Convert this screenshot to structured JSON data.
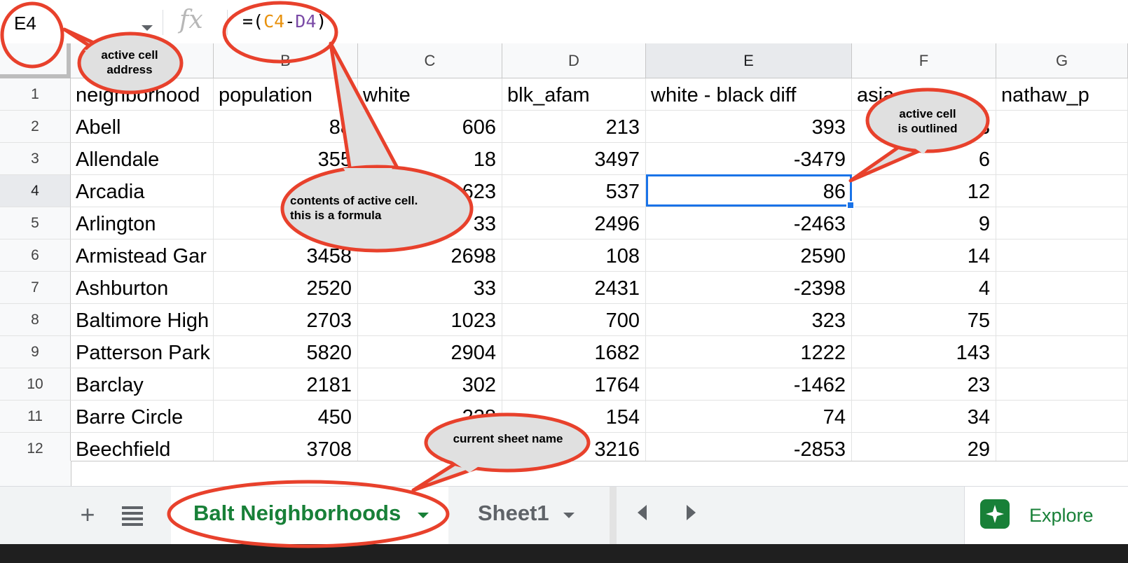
{
  "formula_bar": {
    "name_box": "E4",
    "fx_label": "fx",
    "formula": {
      "prefix": "=(",
      "ref1": "C4",
      "operator": "-",
      "ref2": "D4",
      "suffix": ")"
    }
  },
  "grid": {
    "columns": [
      "B",
      "C",
      "D",
      "E",
      "F",
      "G"
    ],
    "rows": [
      "1",
      "2",
      "3",
      "4",
      "5",
      "6",
      "7",
      "8",
      "9",
      "10",
      "11",
      "12"
    ],
    "header_row": [
      "neighborhood",
      "population",
      "white",
      "blk_afam",
      "white - black diff",
      "asia",
      "nathaw_p"
    ],
    "data": [
      [
        "Abell",
        "88",
        "606",
        "213",
        "393",
        "3",
        ""
      ],
      [
        "Allendale",
        "355",
        "18",
        "3497",
        "-3479",
        "6",
        ""
      ],
      [
        "Arcadia",
        "",
        "623",
        "537",
        "86",
        "12",
        ""
      ],
      [
        "Arlington",
        "",
        "33",
        "2496",
        "-2463",
        "9",
        ""
      ],
      [
        "Armistead Gar",
        "3458",
        "2698",
        "108",
        "2590",
        "14",
        ""
      ],
      [
        "Ashburton",
        "2520",
        "33",
        "2431",
        "-2398",
        "4",
        ""
      ],
      [
        "Baltimore High",
        "2703",
        "1023",
        "700",
        "323",
        "75",
        ""
      ],
      [
        "Patterson Park",
        "5820",
        "2904",
        "1682",
        "1222",
        "143",
        ""
      ],
      [
        "Barclay",
        "2181",
        "302",
        "1764",
        "-1462",
        "23",
        ""
      ],
      [
        "Barre Circle",
        "450",
        "228",
        "154",
        "74",
        "34",
        ""
      ],
      [
        "Beechfield",
        "3708",
        "",
        "3216",
        "-2853",
        "29",
        ""
      ]
    ],
    "active_cell": "E4"
  },
  "sheet_tabs": {
    "add_label": "+",
    "tabs": [
      {
        "name": "Balt Neighborhoods",
        "active": true
      },
      {
        "name": "Sheet1",
        "active": false
      }
    ],
    "explore_label": "Explore"
  },
  "annotations": {
    "active_cell_address": "active cell\naddress",
    "contents_of_active_cell": "contents of active cell.\nthis is a formula",
    "active_cell_outlined": "active cell\nis outlined",
    "current_sheet_name": "current sheet name"
  },
  "colors": {
    "accent_blue": "#1a73e8",
    "sheet_green": "#188038",
    "annotation_red": "#e8412c",
    "callout_fill": "#e0e0e0",
    "ref1_orange": "#e8910c",
    "ref2_purple": "#7a4aa6"
  },
  "icons": {
    "name_box_dropdown": "chevron-down-icon",
    "add_sheet": "plus-icon",
    "all_sheets": "menu-icon",
    "explore": "sparkle-icon",
    "scroll_left": "triangle-left-icon",
    "scroll_right": "triangle-right-icon"
  }
}
